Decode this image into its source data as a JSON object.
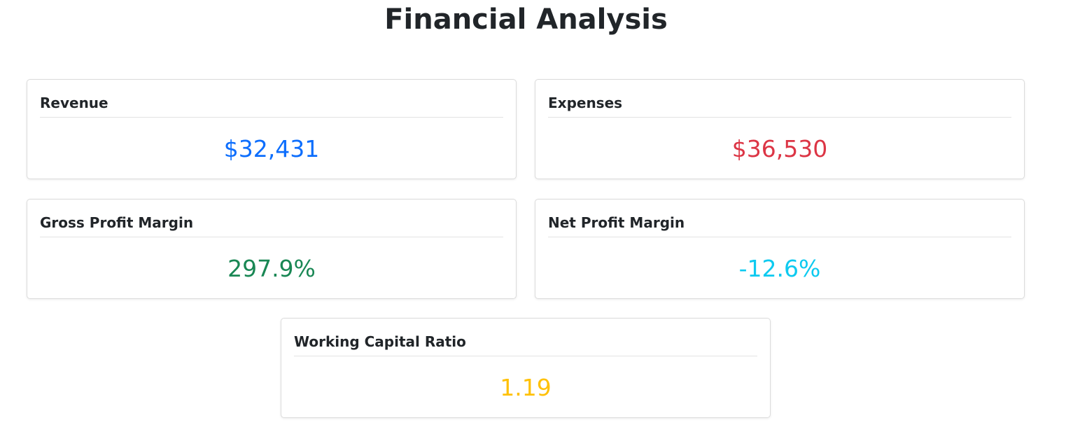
{
  "page": {
    "title": "Financial Analysis"
  },
  "cards": {
    "revenue": {
      "title": "Revenue",
      "value": "$32,431",
      "color": "#0d6efd"
    },
    "expenses": {
      "title": "Expenses",
      "value": "$36,530",
      "color": "#dc3545"
    },
    "gross_profit_margin": {
      "title": "Gross Profit Margin",
      "value": "297.9%",
      "color": "#198754"
    },
    "net_profit_margin": {
      "title": "Net Profit Margin",
      "value": "-12.6%",
      "color": "#0dcaf0"
    },
    "working_capital_ratio": {
      "title": "Working Capital Ratio",
      "value": "1.19",
      "color": "#ffc107"
    }
  }
}
